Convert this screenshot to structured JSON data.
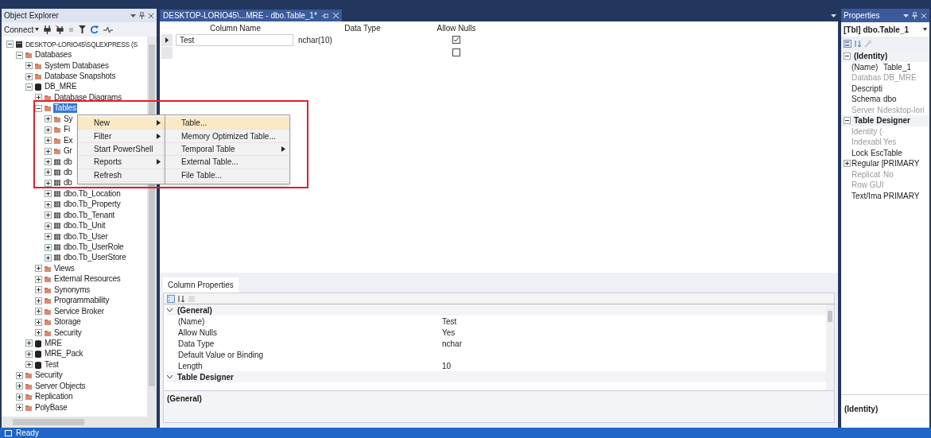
{
  "object_explorer": {
    "title": "Object Explorer",
    "connect": "Connect",
    "tree": [
      {
        "kind": "server",
        "label": "DESKTOP-LORIO45\\SQLEXPRESS (S",
        "expanded": true,
        "selected": false,
        "children": [
          {
            "kind": "folder",
            "label": "Databases",
            "expanded": true,
            "selected": false,
            "children": [
              {
                "kind": "folder",
                "label": "System Databases",
                "expanded": false,
                "selected": false
              },
              {
                "kind": "folder",
                "label": "Database Snapshots",
                "expanded": false,
                "selected": false
              },
              {
                "kind": "database",
                "label": "DB_MRE",
                "expanded": true,
                "selected": false,
                "children": [
                  {
                    "kind": "folder",
                    "label": "Database Diagrams",
                    "expanded": false,
                    "selected": false
                  },
                  {
                    "kind": "folder",
                    "label": "Tables",
                    "expanded": true,
                    "selected": true,
                    "children": [
                      {
                        "kind": "folder",
                        "label": "Sy",
                        "expanded": false,
                        "selected": false
                      },
                      {
                        "kind": "folder",
                        "label": "Fi",
                        "expanded": false,
                        "selected": false
                      },
                      {
                        "kind": "folder",
                        "label": "Ex",
                        "expanded": false,
                        "selected": false
                      },
                      {
                        "kind": "folder",
                        "label": "Gr",
                        "expanded": false,
                        "selected": false
                      },
                      {
                        "kind": "table",
                        "label": "db",
                        "expanded": false,
                        "selected": false
                      },
                      {
                        "kind": "table",
                        "label": "db",
                        "expanded": false,
                        "selected": false
                      },
                      {
                        "kind": "table",
                        "label": "db",
                        "expanded": false,
                        "selected": false
                      },
                      {
                        "kind": "table",
                        "label": "dbo.Tb_Location",
                        "expanded": false,
                        "selected": false
                      },
                      {
                        "kind": "table",
                        "label": "dbo.Tb_Property",
                        "expanded": false,
                        "selected": false
                      },
                      {
                        "kind": "table",
                        "label": "dbo.Tb_Tenant",
                        "expanded": false,
                        "selected": false
                      },
                      {
                        "kind": "table",
                        "label": "dbo.Tb_Unit",
                        "expanded": false,
                        "selected": false
                      },
                      {
                        "kind": "table",
                        "label": "dbo.Tb_User",
                        "expanded": false,
                        "selected": false
                      },
                      {
                        "kind": "table",
                        "label": "dbo.Tb_UserRole",
                        "expanded": false,
                        "selected": false
                      },
                      {
                        "kind": "table",
                        "label": "dbo.Tb_UserStore",
                        "expanded": false,
                        "selected": false
                      }
                    ]
                  },
                  {
                    "kind": "folder",
                    "label": "Views",
                    "expanded": false,
                    "selected": false
                  },
                  {
                    "kind": "folder",
                    "label": "External Resources",
                    "expanded": false,
                    "selected": false
                  },
                  {
                    "kind": "folder",
                    "label": "Synonyms",
                    "expanded": false,
                    "selected": false
                  },
                  {
                    "kind": "folder",
                    "label": "Programmability",
                    "expanded": false,
                    "selected": false
                  },
                  {
                    "kind": "folder",
                    "label": "Service Broker",
                    "expanded": false,
                    "selected": false
                  },
                  {
                    "kind": "folder",
                    "label": "Storage",
                    "expanded": false,
                    "selected": false
                  },
                  {
                    "kind": "folder",
                    "label": "Security",
                    "expanded": false,
                    "selected": false
                  }
                ]
              },
              {
                "kind": "database",
                "label": "MRE",
                "expanded": false,
                "selected": false
              },
              {
                "kind": "database",
                "label": "MRE_Pack",
                "expanded": false,
                "selected": false
              },
              {
                "kind": "database",
                "label": "Test",
                "expanded": false,
                "selected": false
              }
            ]
          },
          {
            "kind": "folder",
            "label": "Security",
            "expanded": false,
            "selected": false
          },
          {
            "kind": "folder",
            "label": "Server Objects",
            "expanded": false,
            "selected": false
          },
          {
            "kind": "folder",
            "label": "Replication",
            "expanded": false,
            "selected": false
          },
          {
            "kind": "folder",
            "label": "PolyBase",
            "expanded": false,
            "selected": false
          }
        ]
      }
    ]
  },
  "context_menu": {
    "items": [
      {
        "label": "New",
        "submenu": true,
        "selected": true
      },
      {
        "label": "Filter",
        "submenu": true,
        "selected": false
      },
      {
        "label": "Start PowerShell",
        "submenu": false,
        "selected": false
      },
      {
        "label": "Reports",
        "submenu": true,
        "selected": false
      },
      {
        "label": "Refresh",
        "submenu": false,
        "selected": false
      }
    ],
    "submenu": [
      {
        "label": "Table...",
        "submenu": false,
        "selected": true
      },
      {
        "label": "Memory Optimized Table...",
        "submenu": false,
        "selected": false
      },
      {
        "label": "Temporal Table",
        "submenu": true,
        "selected": false
      },
      {
        "label": "External Table...",
        "submenu": false,
        "selected": false
      },
      {
        "label": "File Table...",
        "submenu": false,
        "selected": false
      }
    ]
  },
  "editor": {
    "tab": "DESKTOP-LORIO45\\...MRE - dbo.Table_1*",
    "columns": [
      "Column Name",
      "Data Type",
      "Allow Nulls"
    ],
    "rows": [
      {
        "name": "Test",
        "type": "nchar(10)",
        "allow_nulls": true,
        "current": true
      },
      {
        "allow_nulls": false,
        "current": false
      }
    ]
  },
  "column_properties": {
    "tab": "Column Properties",
    "categories": [
      {
        "label": "(General)",
        "expanded": true,
        "rows": [
          {
            "name": "(Name)",
            "value": "Test"
          },
          {
            "name": "Allow Nulls",
            "value": "Yes"
          },
          {
            "name": "Data Type",
            "value": "nchar"
          },
          {
            "name": "Default Value or Binding"
          },
          {
            "name": "Length",
            "value": "10"
          }
        ]
      },
      {
        "label": "Table Designer",
        "expanded": true
      }
    ],
    "description": "(General)"
  },
  "properties": {
    "title": "Properties",
    "object": "[Tbl] dbo.Table_1",
    "categories": [
      {
        "label": "(Identity)",
        "rows": [
          {
            "name": "(Name)",
            "value": "Table_1",
            "readonly": false
          },
          {
            "name": "Databas",
            "value": "DB_MRE",
            "readonly": true
          },
          {
            "name": "Descripti",
            "readonly": false
          },
          {
            "name": "Schema",
            "value": "dbo",
            "readonly": false
          },
          {
            "name": "Server N",
            "value": "desktop-lori",
            "readonly": true
          }
        ]
      },
      {
        "label": "Table Designer",
        "rows": [
          {
            "name": "Identity (",
            "readonly": true
          },
          {
            "name": "Indexabl",
            "value": "Yes",
            "readonly": true
          },
          {
            "name": "Lock Esc",
            "value": "Table",
            "readonly": false
          },
          {
            "name": "Regular [",
            "value": "PRIMARY",
            "readonly": false,
            "expandable": true
          },
          {
            "name": "Replicat",
            "value": "No",
            "readonly": true
          },
          {
            "name": "Row GUI",
            "readonly": true
          },
          {
            "name": "Text/Ima",
            "value": "PRIMARY",
            "readonly": false
          }
        ]
      }
    ],
    "description": "(Identity)"
  },
  "status_bar": {
    "text": "Ready"
  }
}
